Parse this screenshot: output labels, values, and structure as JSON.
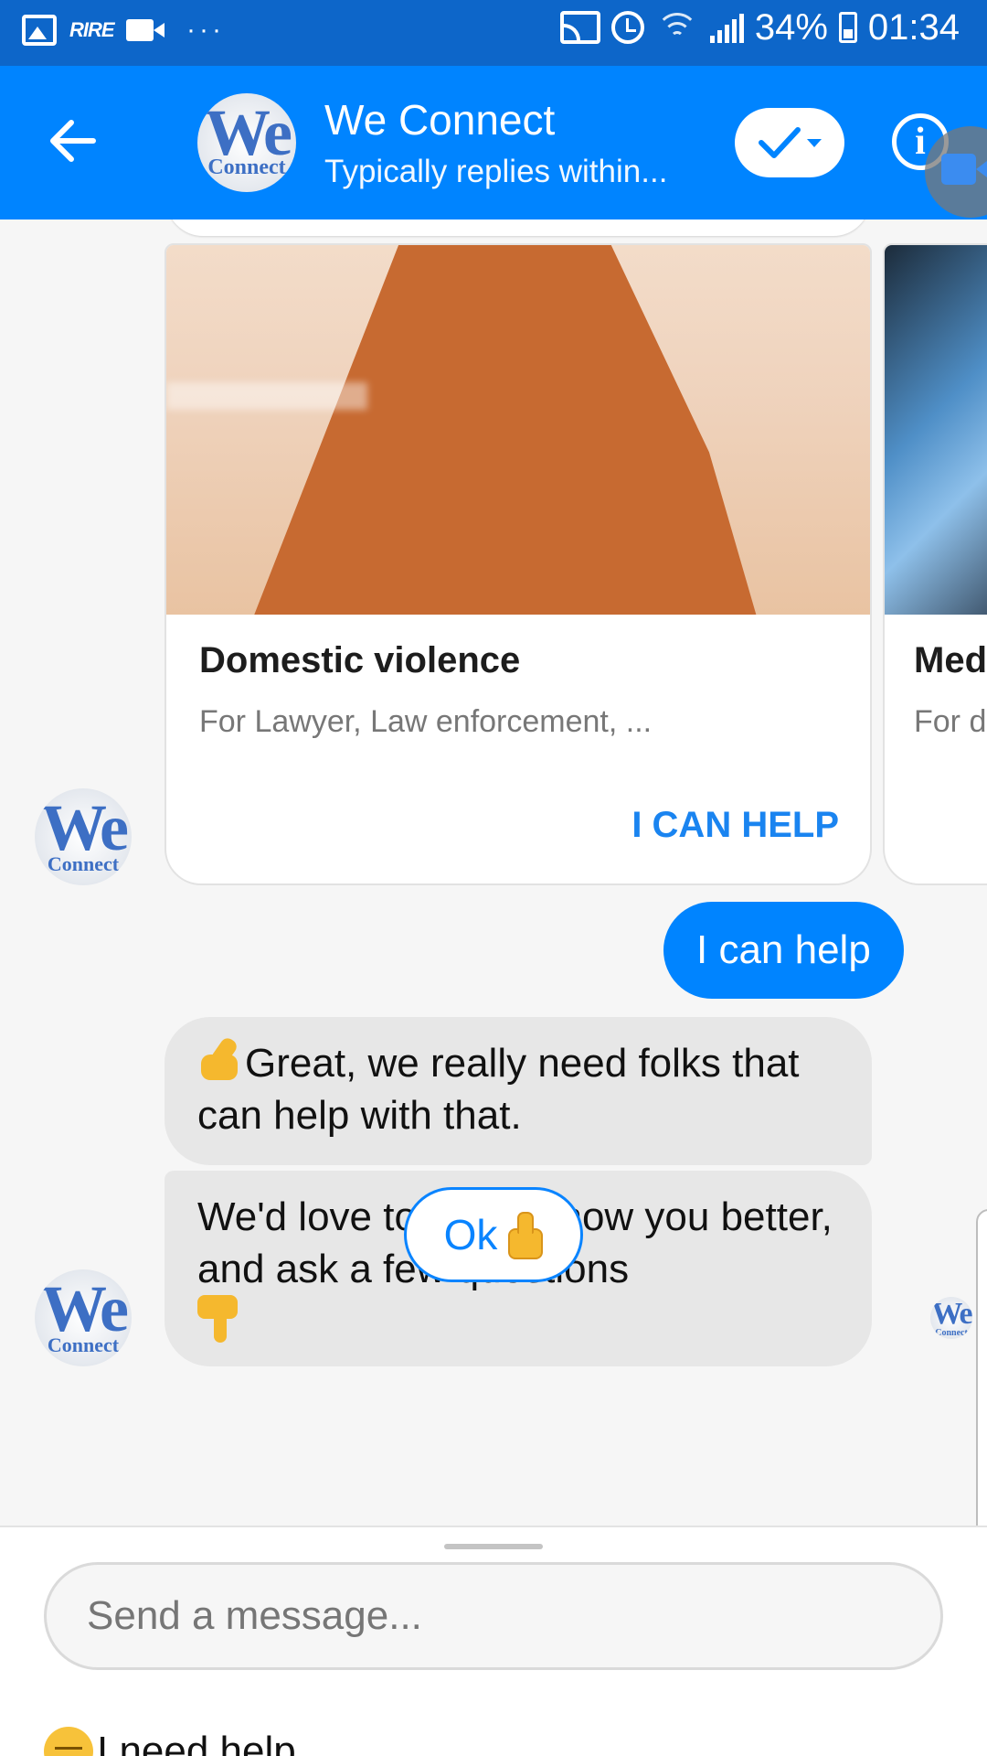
{
  "status_bar": {
    "battery": "34%",
    "time": "01:34",
    "app_badge": "RIRE",
    "more": "···"
  },
  "header": {
    "title": "We Connect",
    "subtitle": "Typically replies within...",
    "logo_text": "We",
    "logo_sub": "Connect"
  },
  "cards": [
    {
      "title": "Domestic violence",
      "subtitle": "For Lawyer, Law enforcement, ...",
      "action": "I CAN HELP"
    },
    {
      "title": "Med",
      "subtitle": "For d"
    }
  ],
  "messages": {
    "user_reply": "I can help",
    "bot_1": "Great, we really need folks that can help with that.",
    "bot_2": "We'd love to get to know you better, and ask a few questions"
  },
  "quick_reply": {
    "label": "Ok"
  },
  "composer": {
    "placeholder": "Send a message...",
    "suggestion": "I need help"
  },
  "colors": {
    "status_bar": "#0d66c9",
    "header": "#0084ff",
    "user_bubble": "#0084ff",
    "bot_bubble": "#e7e7e7",
    "link": "#1a84f0"
  }
}
